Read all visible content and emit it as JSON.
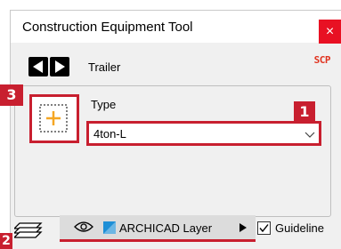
{
  "window": {
    "title": "Construction Equipment Tool",
    "close_label": "×"
  },
  "nav": {
    "item_label": "Trailer",
    "scp_badge": "SCP"
  },
  "markers": {
    "m1": "1",
    "m2": "2",
    "m3": "3"
  },
  "type_field": {
    "label": "Type",
    "value": "4ton-L"
  },
  "layer": {
    "name": "ARCHICAD Layer"
  },
  "guideline": {
    "label": "Guideline",
    "checked": true
  },
  "colors": {
    "highlight": "#c81f2f",
    "accent_orange": "#f5a623",
    "close_red": "#e81123"
  },
  "icons": [
    "prev-arrow-icon",
    "next-arrow-icon",
    "add-object-icon",
    "layers-icon",
    "eye-icon",
    "layer-color-icon",
    "submenu-arrow-icon",
    "check-icon",
    "chevron-down-icon"
  ]
}
